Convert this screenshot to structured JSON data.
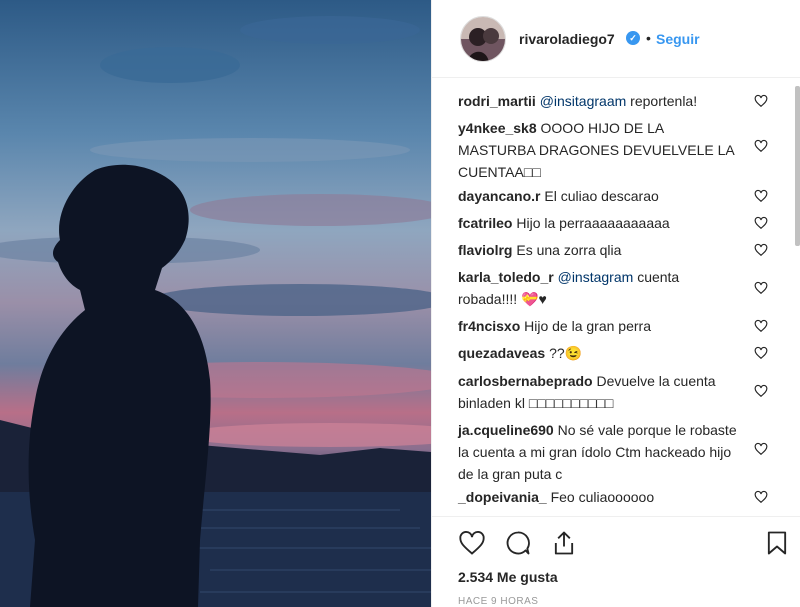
{
  "post": {
    "username": "rivaroladiego7",
    "separator": "•",
    "follow_label": "Seguir",
    "verified_mark": "✓"
  },
  "comments": [
    {
      "user": "rodri_martii",
      "mention": "@insitagraam",
      "text": "reportenla!"
    },
    {
      "user": "y4nkee_sk8",
      "mention": "",
      "text": "OOOO HIJO DE LA MASTURBA DRAGONES DEVUELVELE LA CUENTAA□□"
    },
    {
      "user": "dayancano.r",
      "mention": "",
      "text": "El culiao descarao"
    },
    {
      "user": "fcatrileo",
      "mention": "",
      "text": "Hijo la perraaaaaaaaaaa"
    },
    {
      "user": "flaviolrg",
      "mention": "",
      "text": "Es una zorra qlia"
    },
    {
      "user": "karla_toledo_r",
      "mention": "@instagram",
      "text": "cuenta robada!!!! 💝♥"
    },
    {
      "user": "fr4ncisxo",
      "mention": "",
      "text": "Hijo de la gran perra"
    },
    {
      "user": "quezadaveas",
      "mention": "",
      "text": "??😉"
    },
    {
      "user": "carlosbernabeprado",
      "mention": "",
      "text": "Devuelve la cuenta binladen kl □□□□□□□□□□"
    },
    {
      "user": "ja.cqueline690",
      "mention": "",
      "text": "No sé vale porque le robaste la cuenta a mi gran ídolo Ctm hackeado hijo de la gran puta c"
    },
    {
      "user": "_dopeivania_",
      "mention": "",
      "text": "Feo culiaoooooo"
    }
  ],
  "footer": {
    "likes": "2.534 Me gusta",
    "time": "HACE 9 HORAS"
  },
  "icons": {
    "like": "heart-icon",
    "comment": "comment-bubble-icon",
    "share": "share-icon",
    "save": "bookmark-icon",
    "comment_like": "heart-outline-icon",
    "verified": "verified-badge-icon"
  },
  "colors": {
    "link": "#3897f0",
    "mention": "#003569",
    "text": "#262626",
    "muted": "#999999",
    "verified": "#3897f0"
  }
}
